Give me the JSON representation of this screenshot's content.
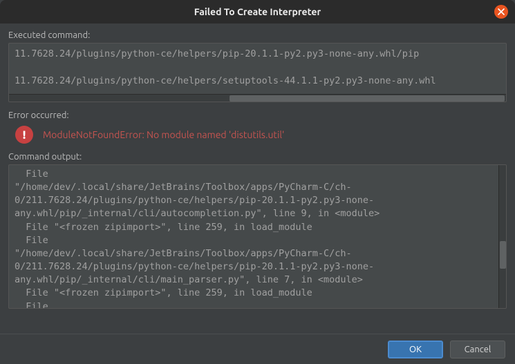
{
  "titlebar": {
    "title": "Failed To Create Interpreter"
  },
  "labels": {
    "executed": "Executed command:",
    "error": "Error occurred:",
    "output": "Command output:"
  },
  "executed_command": "11.7628.24/plugins/python-ce/helpers/pip-20.1.1-py2.py3-none-any.whl/pip\n\n11.7628.24/plugins/python-ce/helpers/setuptools-44.1.1-py2.py3-none-any.whl",
  "error_message": "ModuleNotFoundError: No module named 'distutils.util'",
  "command_output": "  File\n\"/home/dev/.local/share/JetBrains/Toolbox/apps/PyCharm-C/ch-0/211.7628.24/plugins/python-ce/helpers/pip-20.1.1-py2.py3-none-any.whl/pip/_internal/cli/autocompletion.py\", line 9, in <module>\n  File \"<frozen zipimport>\", line 259, in load_module\n  File\n\"/home/dev/.local/share/JetBrains/Toolbox/apps/PyCharm-C/ch-0/211.7628.24/plugins/python-ce/helpers/pip-20.1.1-py2.py3-none-any.whl/pip/_internal/cli/main_parser.py\", line 7, in <module>\n  File \"<frozen zipimport>\", line 259, in load_module\n  File\n\"/home/dev/.local/share/JetBrains/Toolbox/apps/PyCharm-C/ch-0/211.7628.24/plugins/python-ce/helpers/pip-20.1.1-py2.py3-none-any.whl/pip/_internal/",
  "buttons": {
    "ok": "OK",
    "cancel": "Cancel"
  }
}
